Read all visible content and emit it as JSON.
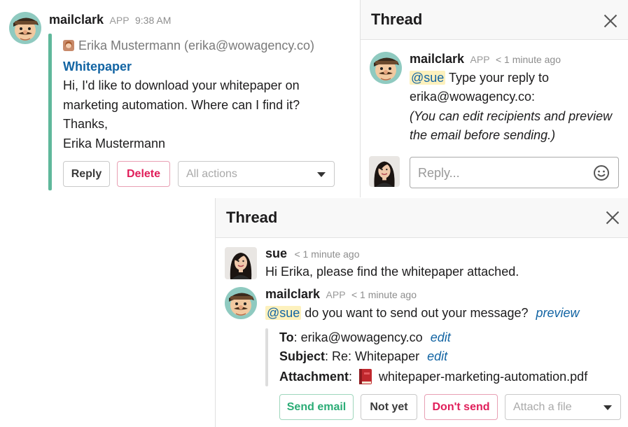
{
  "main_message": {
    "sender": "mailclark",
    "badge": "APP",
    "time": "9:38 AM",
    "from": "Erika Mustermann (erika@wowagency.co)",
    "subject": "Whitepaper",
    "body_lines": [
      "Hi, I'd like to download your whitepaper on",
      "marketing automation. Where can I find it?",
      "Thanks,",
      "Erika Mustermann"
    ],
    "reply_label": "Reply",
    "delete_label": "Delete",
    "actions_placeholder": "All actions"
  },
  "thread1": {
    "title": "Thread",
    "sender": "mailclark",
    "badge": "APP",
    "time": "< 1 minute ago",
    "mention": "@sue",
    "line1_rest": " Type your reply to",
    "line2": "erika@wowagency.co:",
    "note_lines": [
      "(You can edit recipients and preview",
      "the email before sending.)"
    ],
    "reply_placeholder": "Reply..."
  },
  "thread2": {
    "title": "Thread",
    "msg1": {
      "sender": "sue",
      "time": "< 1 minute ago",
      "text": "Hi Erika, please find the whitepaper attached."
    },
    "msg2": {
      "sender": "mailclark",
      "badge": "APP",
      "time": "< 1 minute ago",
      "mention": "@sue",
      "text": " do you want to send out your message?",
      "preview_link": "preview",
      "to_label": "To",
      "to_value": ": erika@wowagency.co",
      "to_edit": "edit",
      "subject_label": "Subject",
      "subject_value": ": Re: Whitepaper",
      "subject_edit": "edit",
      "attachment_label": "Attachment",
      "attachment_sep": ":",
      "attachment_file": "whitepaper-marketing-automation.pdf",
      "send_label": "Send email",
      "notyet_label": "Not yet",
      "dontsend_label": "Don't send",
      "attach_placeholder": "Attach a file"
    }
  },
  "colors": {
    "link": "#1264a3",
    "mention_bg": "#fdf1bd",
    "quote_bar": "#5fb89b",
    "danger": "#e01e5a",
    "success": "#2bac76"
  },
  "icons": {
    "bot_avatar": "mailclark-avatar",
    "user_avatar": "sue-avatar",
    "emoji": "smiley-icon",
    "close": "close-icon",
    "book": "book-icon",
    "dropdown": "chevron-down-icon"
  }
}
